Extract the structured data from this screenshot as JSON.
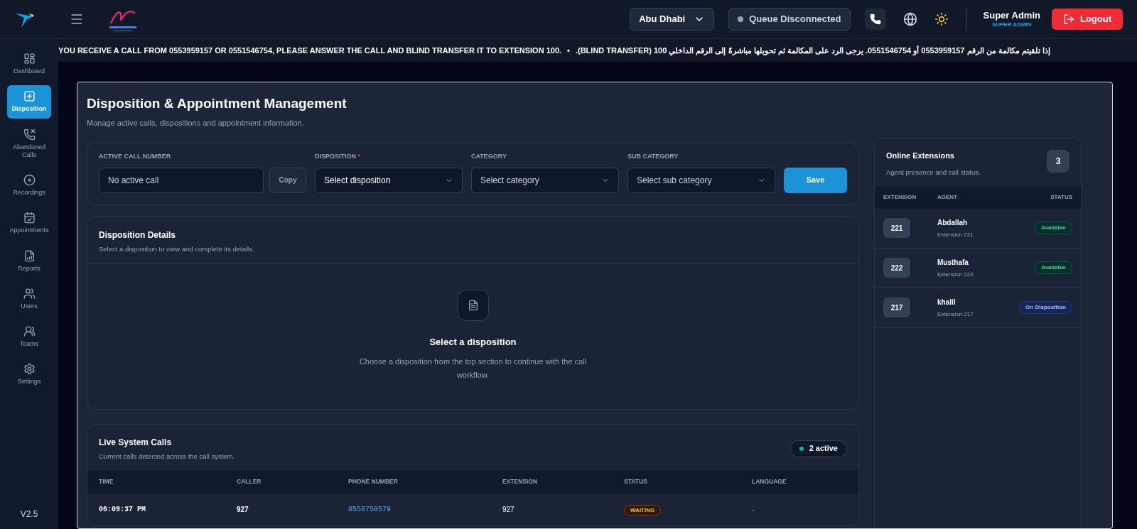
{
  "topbar": {
    "location": "Abu Dhabi",
    "queue_status": "Queue Disconnected",
    "queue_connected": false,
    "user_name": "Super Admin",
    "user_role": "SUPER ADMIN",
    "logout": "Logout"
  },
  "ticker": {
    "english": "YOU RECEIVE A CALL FROM 0553959157 OR 0551546754, PLEASE ANSWER THE CALL AND BLIND TRANSFER IT TO EXTENSION 100.",
    "separator": "•",
    "arabic": "إذا تلقيتم مكالمة من الرقم 0553959157 أو 0551546754. يرجى الرد على المكالمة ثم تحويلها مباشرةً إلى الرقم الداخلي 100 (BLIND TRANSFER)."
  },
  "sidebar": {
    "items": [
      {
        "kind": "dashboard",
        "label": "Dashboard",
        "selected": false
      },
      {
        "kind": "disposition",
        "label": "Disposition",
        "selected": true
      },
      {
        "kind": "abandoned",
        "label": "Abandoned Calls",
        "selected": false
      },
      {
        "kind": "recordings",
        "label": "Recordings",
        "selected": false
      },
      {
        "kind": "appointments",
        "label": "Appointments",
        "selected": false
      },
      {
        "kind": "reports",
        "label": "Reports",
        "selected": false
      },
      {
        "kind": "users",
        "label": "Users",
        "selected": false
      },
      {
        "kind": "teams",
        "label": "Teams",
        "selected": false
      },
      {
        "kind": "settings",
        "label": "Settings",
        "selected": false
      }
    ],
    "version": "V2.5"
  },
  "page": {
    "title": "Disposition & Appointment Management",
    "subtitle": "Manage active calls, dispositions and appointment information."
  },
  "form": {
    "active_call": {
      "label": "ACTIVE CALL NUMBER",
      "placeholder": "No active call",
      "copy": "Copy"
    },
    "selects": [
      {
        "label": "DISPOSITION",
        "required_mark": "*",
        "placeholder": "Select disposition"
      },
      {
        "label": "CATEGORY",
        "placeholder": "Select category"
      },
      {
        "label": "SUB CATEGORY",
        "placeholder": "Select sub category"
      }
    ],
    "save": "Save"
  },
  "details": {
    "title": "Disposition Details",
    "subtitle": "Select a disposition to view and complete its details.",
    "empty_title": "Select a disposition",
    "empty_text": "Choose a disposition from the top section to continue with the call workflow."
  },
  "live_calls": {
    "title": "Live System Calls",
    "subtitle": "Current calls detected across the call system.",
    "badge": "2 active",
    "columns": [
      "TIME",
      "CALLER",
      "PHONE NUMBER",
      "EXTENSION",
      "STATUS",
      "LANGUAGE"
    ],
    "rows": [
      {
        "time": "06:09:37 PM",
        "caller": "927",
        "phone": "0558750579",
        "extension": "927",
        "status": "WAITING",
        "language": "-"
      }
    ]
  },
  "extensions": {
    "title": "Online Extensions",
    "subtitle": "Agent presence and call status.",
    "count": "3",
    "columns": [
      "EXTENSION",
      "AGENT",
      "STATUS"
    ],
    "rows": [
      {
        "extension": "221",
        "agent": "Abdallah",
        "detail": "Extension 221",
        "status": "Available",
        "kind": "available"
      },
      {
        "extension": "222",
        "agent": "Musthafa",
        "detail": "Extension 222",
        "status": "Available",
        "kind": "available"
      },
      {
        "extension": "217",
        "agent": "khalil",
        "detail": "Extension 217",
        "status": "On Disposition",
        "kind": "disposition"
      }
    ]
  }
}
